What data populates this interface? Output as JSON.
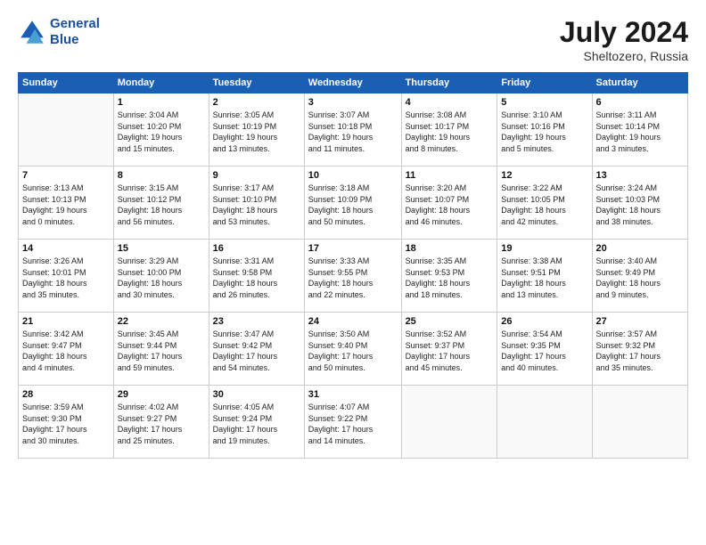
{
  "logo": {
    "line1": "General",
    "line2": "Blue"
  },
  "title": "July 2024",
  "subtitle": "Sheltozero, Russia",
  "days_of_week": [
    "Sunday",
    "Monday",
    "Tuesday",
    "Wednesday",
    "Thursday",
    "Friday",
    "Saturday"
  ],
  "weeks": [
    [
      {
        "num": "",
        "info": ""
      },
      {
        "num": "1",
        "info": "Sunrise: 3:04 AM\nSunset: 10:20 PM\nDaylight: 19 hours\nand 15 minutes."
      },
      {
        "num": "2",
        "info": "Sunrise: 3:05 AM\nSunset: 10:19 PM\nDaylight: 19 hours\nand 13 minutes."
      },
      {
        "num": "3",
        "info": "Sunrise: 3:07 AM\nSunset: 10:18 PM\nDaylight: 19 hours\nand 11 minutes."
      },
      {
        "num": "4",
        "info": "Sunrise: 3:08 AM\nSunset: 10:17 PM\nDaylight: 19 hours\nand 8 minutes."
      },
      {
        "num": "5",
        "info": "Sunrise: 3:10 AM\nSunset: 10:16 PM\nDaylight: 19 hours\nand 5 minutes."
      },
      {
        "num": "6",
        "info": "Sunrise: 3:11 AM\nSunset: 10:14 PM\nDaylight: 19 hours\nand 3 minutes."
      }
    ],
    [
      {
        "num": "7",
        "info": "Sunrise: 3:13 AM\nSunset: 10:13 PM\nDaylight: 19 hours\nand 0 minutes."
      },
      {
        "num": "8",
        "info": "Sunrise: 3:15 AM\nSunset: 10:12 PM\nDaylight: 18 hours\nand 56 minutes."
      },
      {
        "num": "9",
        "info": "Sunrise: 3:17 AM\nSunset: 10:10 PM\nDaylight: 18 hours\nand 53 minutes."
      },
      {
        "num": "10",
        "info": "Sunrise: 3:18 AM\nSunset: 10:09 PM\nDaylight: 18 hours\nand 50 minutes."
      },
      {
        "num": "11",
        "info": "Sunrise: 3:20 AM\nSunset: 10:07 PM\nDaylight: 18 hours\nand 46 minutes."
      },
      {
        "num": "12",
        "info": "Sunrise: 3:22 AM\nSunset: 10:05 PM\nDaylight: 18 hours\nand 42 minutes."
      },
      {
        "num": "13",
        "info": "Sunrise: 3:24 AM\nSunset: 10:03 PM\nDaylight: 18 hours\nand 38 minutes."
      }
    ],
    [
      {
        "num": "14",
        "info": "Sunrise: 3:26 AM\nSunset: 10:01 PM\nDaylight: 18 hours\nand 35 minutes."
      },
      {
        "num": "15",
        "info": "Sunrise: 3:29 AM\nSunset: 10:00 PM\nDaylight: 18 hours\nand 30 minutes."
      },
      {
        "num": "16",
        "info": "Sunrise: 3:31 AM\nSunset: 9:58 PM\nDaylight: 18 hours\nand 26 minutes."
      },
      {
        "num": "17",
        "info": "Sunrise: 3:33 AM\nSunset: 9:55 PM\nDaylight: 18 hours\nand 22 minutes."
      },
      {
        "num": "18",
        "info": "Sunrise: 3:35 AM\nSunset: 9:53 PM\nDaylight: 18 hours\nand 18 minutes."
      },
      {
        "num": "19",
        "info": "Sunrise: 3:38 AM\nSunset: 9:51 PM\nDaylight: 18 hours\nand 13 minutes."
      },
      {
        "num": "20",
        "info": "Sunrise: 3:40 AM\nSunset: 9:49 PM\nDaylight: 18 hours\nand 9 minutes."
      }
    ],
    [
      {
        "num": "21",
        "info": "Sunrise: 3:42 AM\nSunset: 9:47 PM\nDaylight: 18 hours\nand 4 minutes."
      },
      {
        "num": "22",
        "info": "Sunrise: 3:45 AM\nSunset: 9:44 PM\nDaylight: 17 hours\nand 59 minutes."
      },
      {
        "num": "23",
        "info": "Sunrise: 3:47 AM\nSunset: 9:42 PM\nDaylight: 17 hours\nand 54 minutes."
      },
      {
        "num": "24",
        "info": "Sunrise: 3:50 AM\nSunset: 9:40 PM\nDaylight: 17 hours\nand 50 minutes."
      },
      {
        "num": "25",
        "info": "Sunrise: 3:52 AM\nSunset: 9:37 PM\nDaylight: 17 hours\nand 45 minutes."
      },
      {
        "num": "26",
        "info": "Sunrise: 3:54 AM\nSunset: 9:35 PM\nDaylight: 17 hours\nand 40 minutes."
      },
      {
        "num": "27",
        "info": "Sunrise: 3:57 AM\nSunset: 9:32 PM\nDaylight: 17 hours\nand 35 minutes."
      }
    ],
    [
      {
        "num": "28",
        "info": "Sunrise: 3:59 AM\nSunset: 9:30 PM\nDaylight: 17 hours\nand 30 minutes."
      },
      {
        "num": "29",
        "info": "Sunrise: 4:02 AM\nSunset: 9:27 PM\nDaylight: 17 hours\nand 25 minutes."
      },
      {
        "num": "30",
        "info": "Sunrise: 4:05 AM\nSunset: 9:24 PM\nDaylight: 17 hours\nand 19 minutes."
      },
      {
        "num": "31",
        "info": "Sunrise: 4:07 AM\nSunset: 9:22 PM\nDaylight: 17 hours\nand 14 minutes."
      },
      {
        "num": "",
        "info": ""
      },
      {
        "num": "",
        "info": ""
      },
      {
        "num": "",
        "info": ""
      }
    ]
  ]
}
